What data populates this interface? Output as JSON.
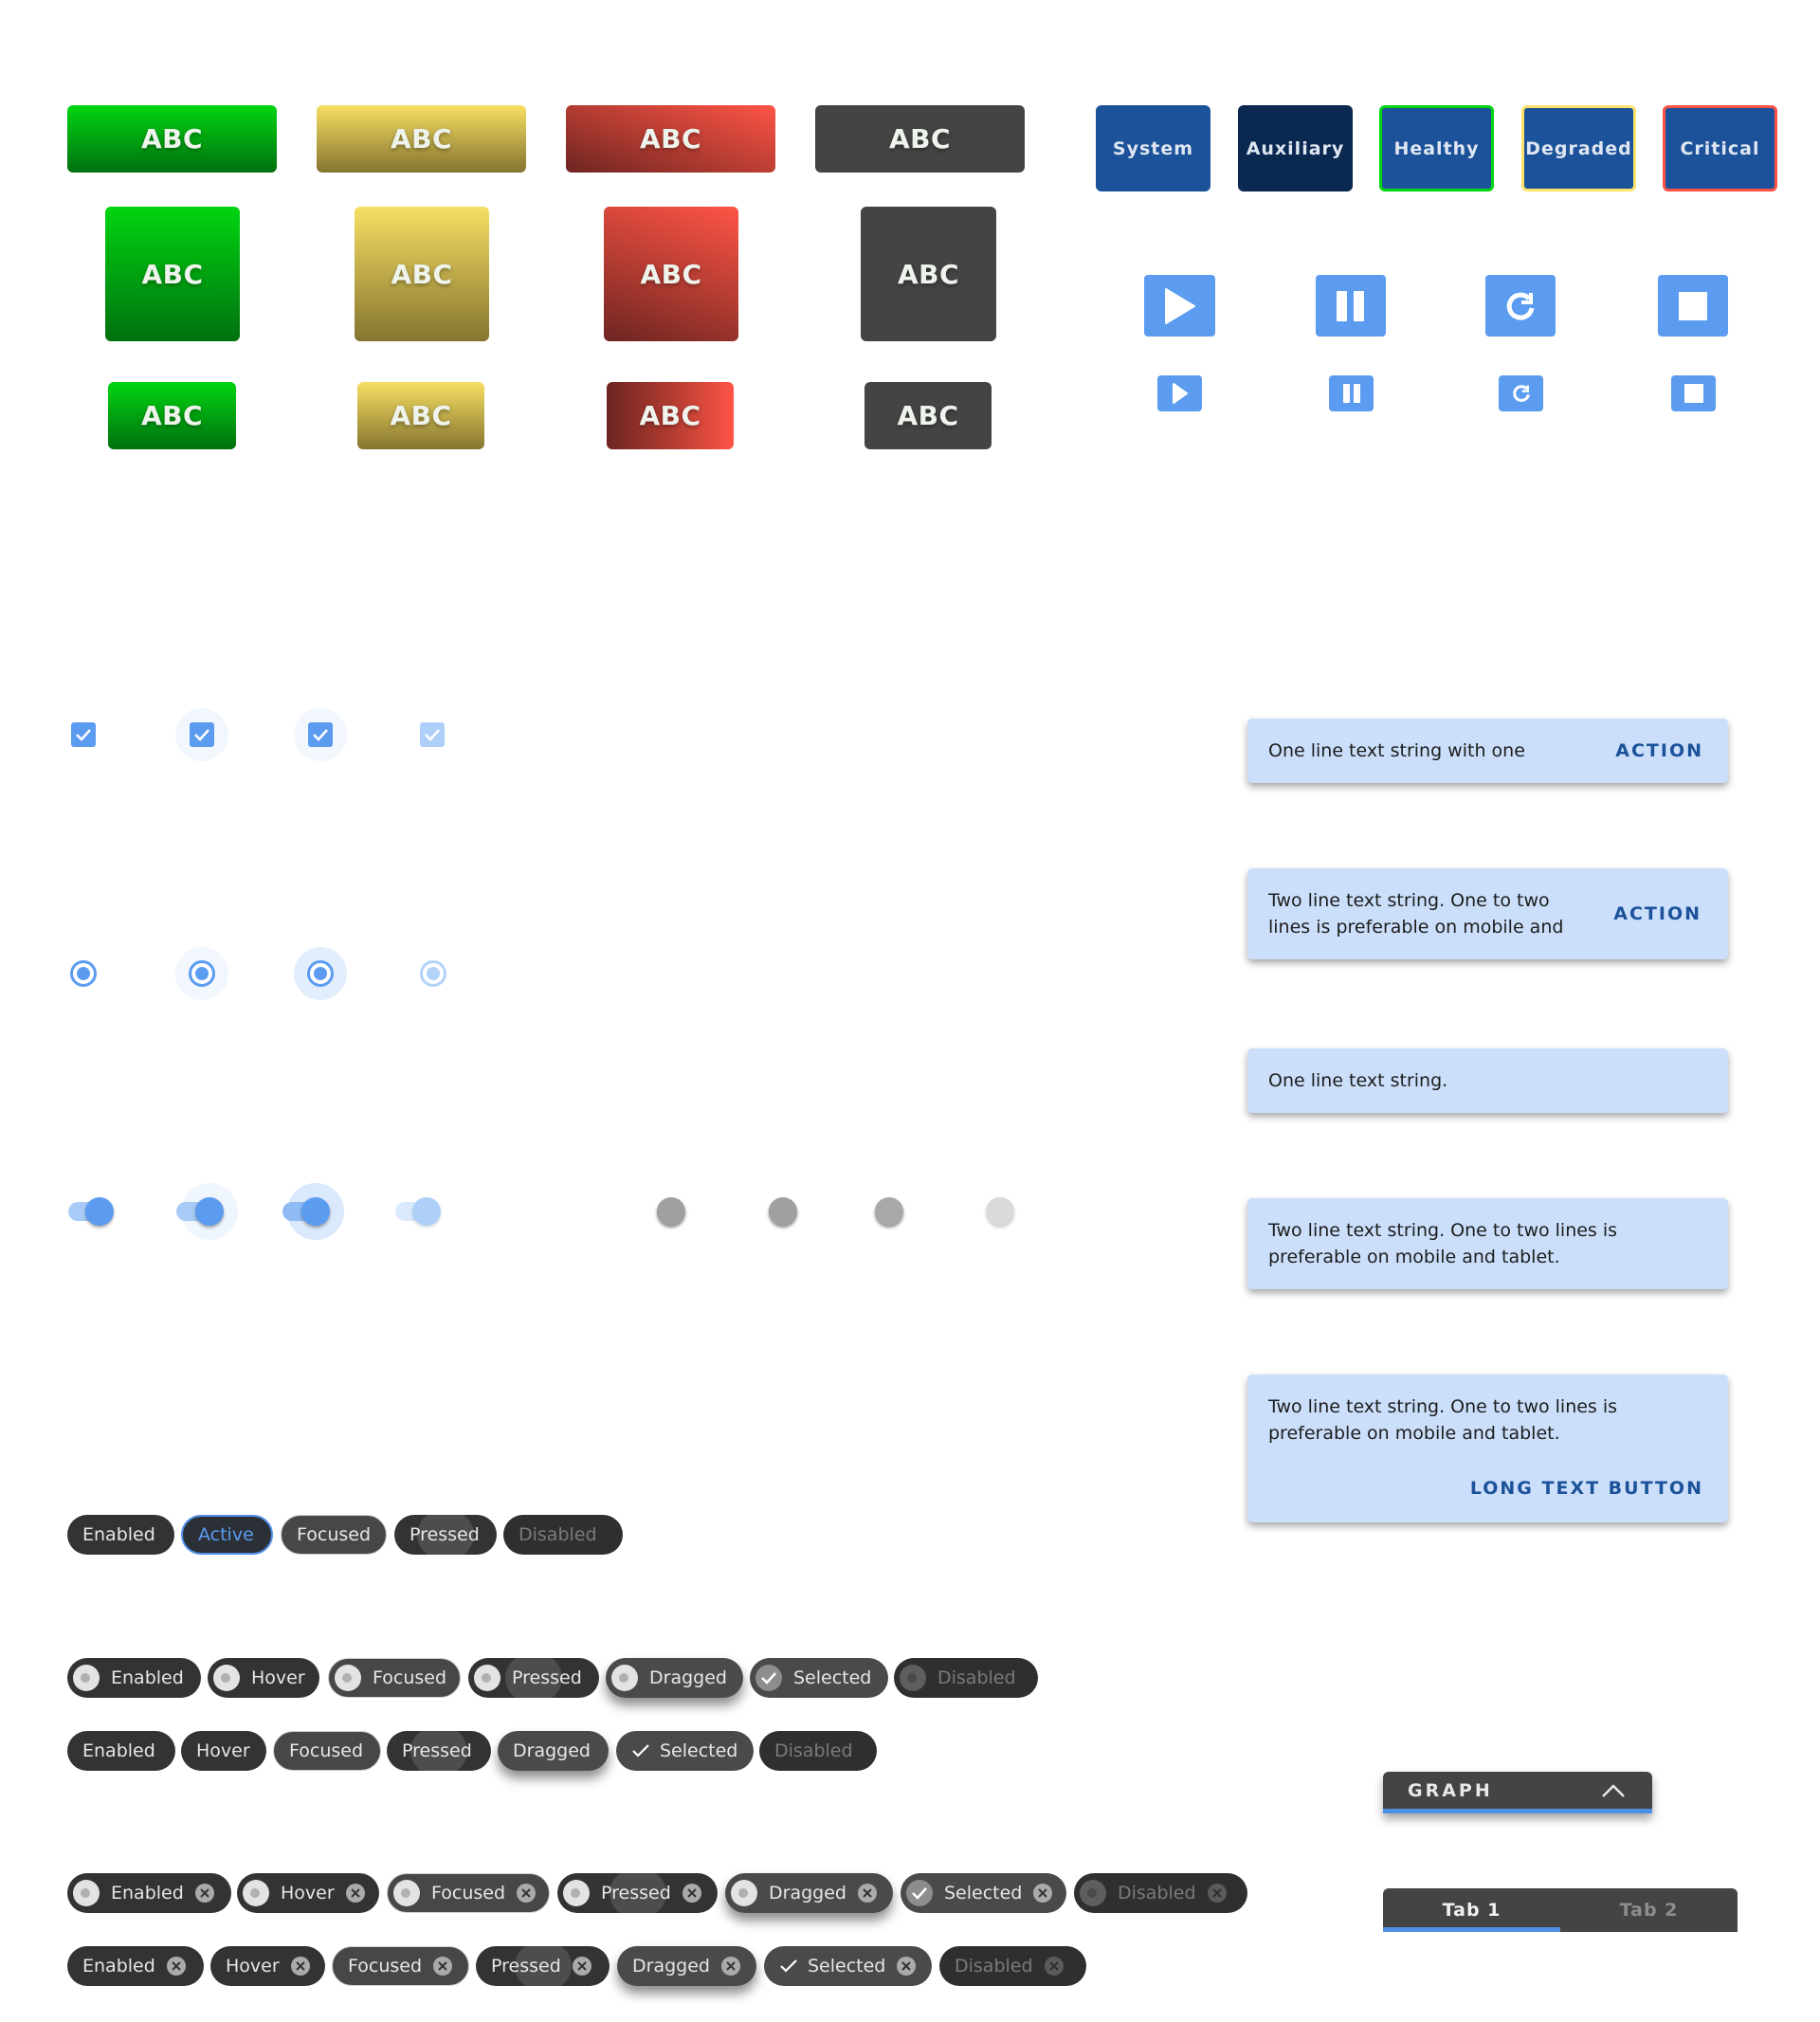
{
  "status_buttons": {
    "label": "ABC",
    "colors": {
      "green": "#00b010",
      "yellow": "#c9b34a",
      "red": "#d04436",
      "dark": "#444444"
    },
    "rows": [
      [
        "ABC",
        "ABC",
        "ABC",
        "ABC"
      ],
      [
        "ABC",
        "ABC",
        "ABC",
        "ABC"
      ],
      [
        "ABC",
        "ABC",
        "ABC",
        "ABC"
      ]
    ]
  },
  "nav_buttons": [
    {
      "label": "System",
      "background": "#1c5299",
      "border": "none"
    },
    {
      "label": "Auxiliary",
      "background": "#0a2850",
      "border": "none"
    },
    {
      "label": "Healthy",
      "background": "#1c5299",
      "border": "#00d511"
    },
    {
      "label": "Degraded",
      "background": "#1c5299",
      "border": "#fde36b"
    },
    {
      "label": "Critical",
      "background": "#1c5299",
      "border": "#fe5446"
    }
  ],
  "media_buttons": {
    "large": [
      "play-icon",
      "pause-icon",
      "replay-icon",
      "stop-icon"
    ],
    "small": [
      "play-icon",
      "pause-icon",
      "replay-icon",
      "stop-icon"
    ],
    "color": "#5b9cf1"
  },
  "checkboxes": [
    {
      "state": "enabled",
      "checked": true
    },
    {
      "state": "hover",
      "checked": true
    },
    {
      "state": "focused",
      "checked": true
    },
    {
      "state": "disabled",
      "checked": true
    }
  ],
  "radios": [
    {
      "state": "enabled",
      "selected": true
    },
    {
      "state": "hover",
      "selected": true
    },
    {
      "state": "focused",
      "selected": true
    },
    {
      "state": "disabled",
      "selected": true
    }
  ],
  "toggles_on": [
    {
      "state": "enabled",
      "on": true
    },
    {
      "state": "hover",
      "on": true
    },
    {
      "state": "focused",
      "on": true
    },
    {
      "state": "disabled",
      "on": true
    }
  ],
  "toggles_off": [
    {
      "state": "enabled",
      "on": false
    },
    {
      "state": "hover",
      "on": false
    },
    {
      "state": "focused",
      "on": false
    },
    {
      "state": "disabled",
      "on": false
    }
  ],
  "snackbars": [
    {
      "text": "One line text string with one",
      "action": "ACTION"
    },
    {
      "text_line1": "Two line text string. One to two",
      "text_line2": "lines is preferable on mobile and",
      "action": "ACTION"
    },
    {
      "text": "One line text string."
    },
    {
      "text_line1": "Two line text string. One to two lines is",
      "text_line2": "preferable on mobile and tablet."
    },
    {
      "text_line1": "Two line text string. One to two lines is",
      "text_line2": "preferable on mobile and tablet.",
      "action": "LONG TEXT BUTTON"
    }
  ],
  "chips": {
    "basic": [
      "Enabled",
      "Active",
      "Focused",
      "Pressed",
      "Disabled"
    ],
    "avatar_chips": [
      "Enabled",
      "Hover",
      "Focused",
      "Pressed",
      "Dragged",
      "Selected",
      "Disabled"
    ],
    "filter_chips": [
      "Enabled",
      "Hover",
      "Focused",
      "Pressed",
      "Dragged",
      "Selected",
      "Disabled"
    ],
    "avatar_input_chips": [
      "Enabled",
      "Hover",
      "Focused",
      "Pressed",
      "Dragged",
      "Selected",
      "Disabled"
    ],
    "input_chips": [
      "Enabled",
      "Hover",
      "Focused",
      "Pressed",
      "Dragged",
      "Selected",
      "Disabled"
    ]
  },
  "accordion": {
    "title": "GRAPH",
    "expanded": true
  },
  "tabs": {
    "items": [
      "Tab 1",
      "Tab 2"
    ],
    "selected": 0
  }
}
